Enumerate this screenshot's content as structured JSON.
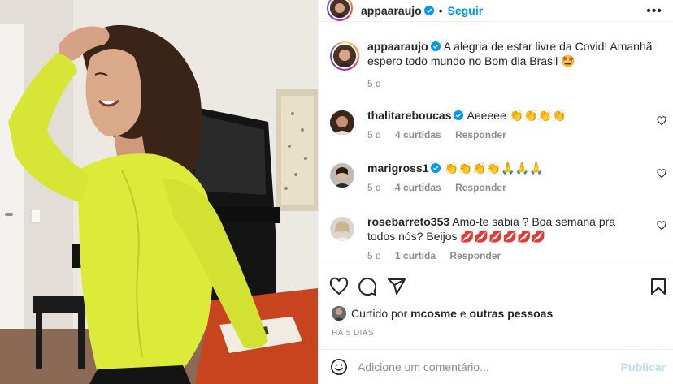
{
  "post": {
    "author": "appaaraujo",
    "follow_label": "Seguir",
    "caption": "A alegria de estar livre da Covid! Amanhã espero todo mundo no Bom dia Brasil 🤩",
    "caption_age": "5 d"
  },
  "comments": [
    {
      "user": "thalitareboucas",
      "verified": true,
      "text": "Aeeeee 👏👏👏👏",
      "age": "5 d",
      "likes": "4 curtidas",
      "reply": "Responder"
    },
    {
      "user": "marigross1",
      "verified": true,
      "text": "👏👏👏👏🙏🙏🙏",
      "age": "5 d",
      "likes": "4 curtidas",
      "reply": "Responder"
    },
    {
      "user": "rosebarreto353",
      "verified": false,
      "text": "Amo-te sabia ? Boa semana pra todos nós? Beijos 💋💋💋💋💋💋",
      "age": "5 d",
      "likes": "1 curtida",
      "reply": "Responder"
    }
  ],
  "likes": {
    "prefix": "Curtido por",
    "user": "mcosme",
    "joiner": "e",
    "others": "outras pessoas"
  },
  "posted_ago": "HÁ 5 DIAS",
  "comment_box": {
    "placeholder": "Adicione um comentário...",
    "publish_label": "Publicar"
  },
  "icons": [
    "more-icon",
    "heart-icon",
    "comment-icon",
    "share-icon",
    "bookmark-icon",
    "emoji-icon",
    "verified-icon"
  ],
  "colors": {
    "accent": "#0095f6",
    "publish_disabled": "#b2dffc",
    "muted": "#8e8e8e",
    "shirt": "#dcea3a"
  }
}
